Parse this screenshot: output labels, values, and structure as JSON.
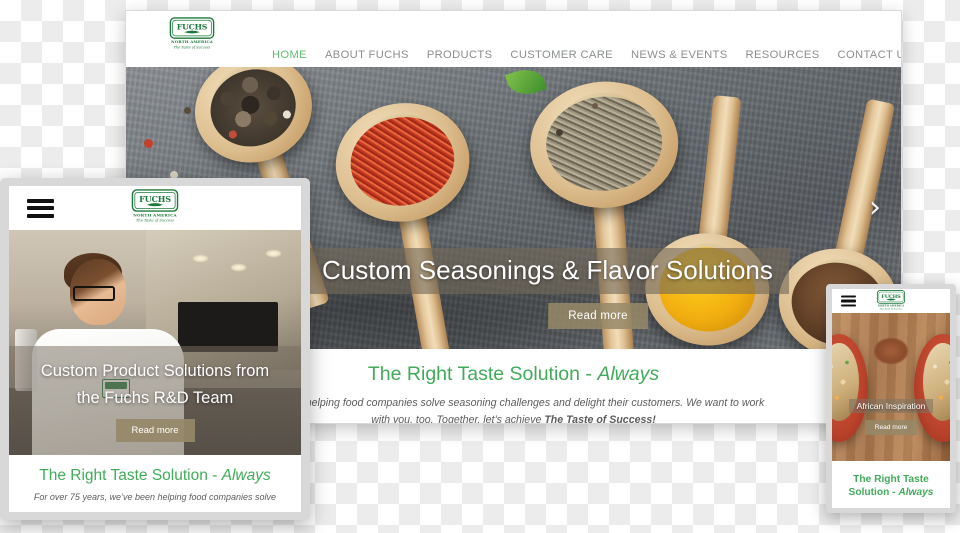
{
  "brand": {
    "name": "FUCHS",
    "region": "NORTH AMERICA",
    "tagline": "The Taste of Success",
    "green": "#1e7a3c",
    "accent_green": "#41ab5a",
    "nav_active_green": "#5bbf6e",
    "button_tan": "#968868"
  },
  "desktop": {
    "nav": {
      "items": [
        {
          "label": "HOME",
          "active": true
        },
        {
          "label": "ABOUT FUCHS",
          "active": false
        },
        {
          "label": "PRODUCTS",
          "active": false
        },
        {
          "label": "CUSTOMER CARE",
          "active": false
        },
        {
          "label": "NEWS & EVENTS",
          "active": false
        },
        {
          "label": "RESOURCES",
          "active": false
        },
        {
          "label": "CONTACT US",
          "active": false
        }
      ]
    },
    "hero": {
      "caption": "Custom Seasonings & Flavor Solutions",
      "button": "Read more",
      "next_arrow": "›",
      "image_description": "wooden spoons with peppercorns, saffron, dried herbs, turmeric and star anise on slate"
    },
    "tagline": {
      "headline_plain": "The Right Taste Solution - ",
      "headline_italic": "Always",
      "body_part1": "’ve been helping food companies solve seasoning challenges and delight their customers. We want to work with you, too. Together, let’s achieve ",
      "body_bold": "The Taste of Success!"
    }
  },
  "tablet": {
    "menu_icon": "hamburger-icon",
    "hero": {
      "caption_line1": "Custom Product Solutions from",
      "caption_line2": "the Fuchs R&D Team",
      "button": "Read more",
      "image_description": "food scientist in white lab coat working in a laboratory kitchen"
    },
    "tagline": {
      "headline_plain": "The Right Taste Solution - ",
      "headline_italic": "Always",
      "body": "For over 75 years, we’ve been helping food companies solve"
    }
  },
  "phone": {
    "menu_icon": "hamburger-icon",
    "hero": {
      "caption": "African Inspiration",
      "button": "Read more",
      "image_description": "two red bowls of grain salad on a wooden table with ground spice"
    },
    "tagline": {
      "line1": "The Right Taste",
      "line2_plain": "Solution - ",
      "line2_italic": "Always"
    }
  }
}
